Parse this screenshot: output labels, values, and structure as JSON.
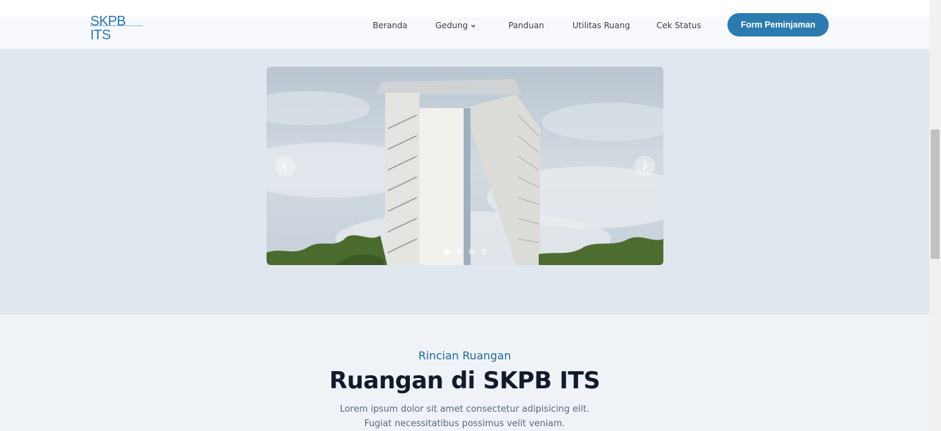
{
  "header": {
    "logo_text": "SKPB ITS",
    "nav": {
      "beranda": "Beranda",
      "gedung": "Gedung",
      "panduan": "Panduan",
      "utilitas": "Utilitas Ruang",
      "cek_status": "Cek Status"
    },
    "cta_label": "Form Peminjaman"
  },
  "carousel": {
    "slide_count": 4,
    "active_index": 0,
    "prev_icon": "chevron-left-icon",
    "next_icon": "chevron-right-icon"
  },
  "section": {
    "eyebrow": "Rincian Ruangan",
    "title": "Ruangan di SKPB ITS",
    "description": "Lorem ipsum dolor sit amet consectetur adipisicing elit. Fugiat necessitatibus possimus velit veniam."
  },
  "colors": {
    "accent": "#2b7bb0",
    "eyebrow": "#1f6b99",
    "title": "#121b2b",
    "hero_bg": "#e1e7ef",
    "section_bg": "#eff3f8"
  }
}
